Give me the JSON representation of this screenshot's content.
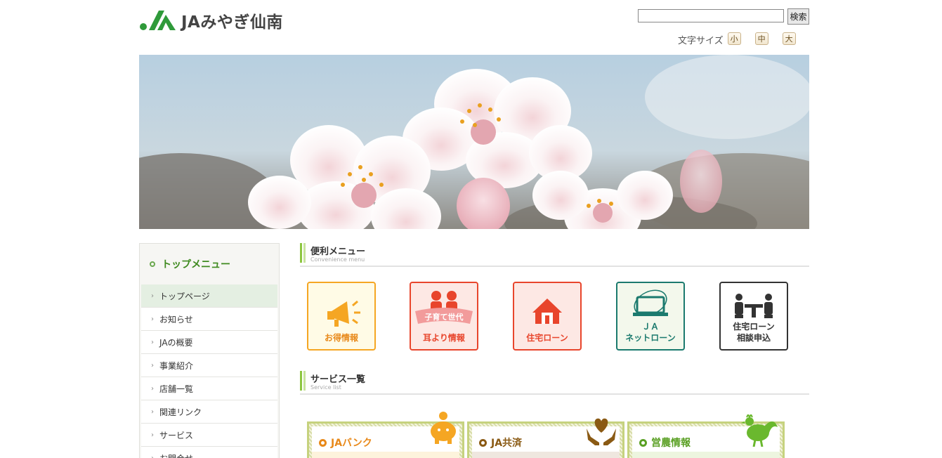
{
  "header": {
    "logo_text": "JAみやぎ仙南",
    "search": {
      "value": "",
      "button_label": "検索"
    },
    "font_size": {
      "label": "文字サイズ",
      "small": "小",
      "medium": "中",
      "large": "大"
    }
  },
  "sidebar": {
    "title": "トップメニュー",
    "items": [
      {
        "label": "トップページ"
      },
      {
        "label": "お知らせ"
      },
      {
        "label": "JAの概要"
      },
      {
        "label": "事業紹介"
      },
      {
        "label": "店舗一覧"
      },
      {
        "label": "関連リンク"
      },
      {
        "label": "サービス"
      },
      {
        "label": "お問合せ"
      }
    ]
  },
  "convenience": {
    "title": "便利メニュー",
    "subtitle": "Convenience menu",
    "tiles": [
      {
        "label": "お得情報",
        "color": "#f5a623"
      },
      {
        "badge": "子育て世代",
        "label": "耳より情報",
        "color": "#e8452c"
      },
      {
        "label": "住宅ローン",
        "color": "#e8452c"
      },
      {
        "label_line1": "ＪＡ",
        "label_line2": "ネットローン",
        "color": "#1b7a6e"
      },
      {
        "label_line1": "住宅ローン",
        "label_line2": "相談申込",
        "color": "#333333"
      }
    ]
  },
  "services": {
    "title": "サービス一覧",
    "subtitle": "Service list",
    "tabs": [
      {
        "label": "JAバンク",
        "color": "#e8891a"
      },
      {
        "label": "JA共済",
        "color": "#8a5a14"
      },
      {
        "label": "営農情報",
        "color": "#5aa024"
      }
    ]
  }
}
